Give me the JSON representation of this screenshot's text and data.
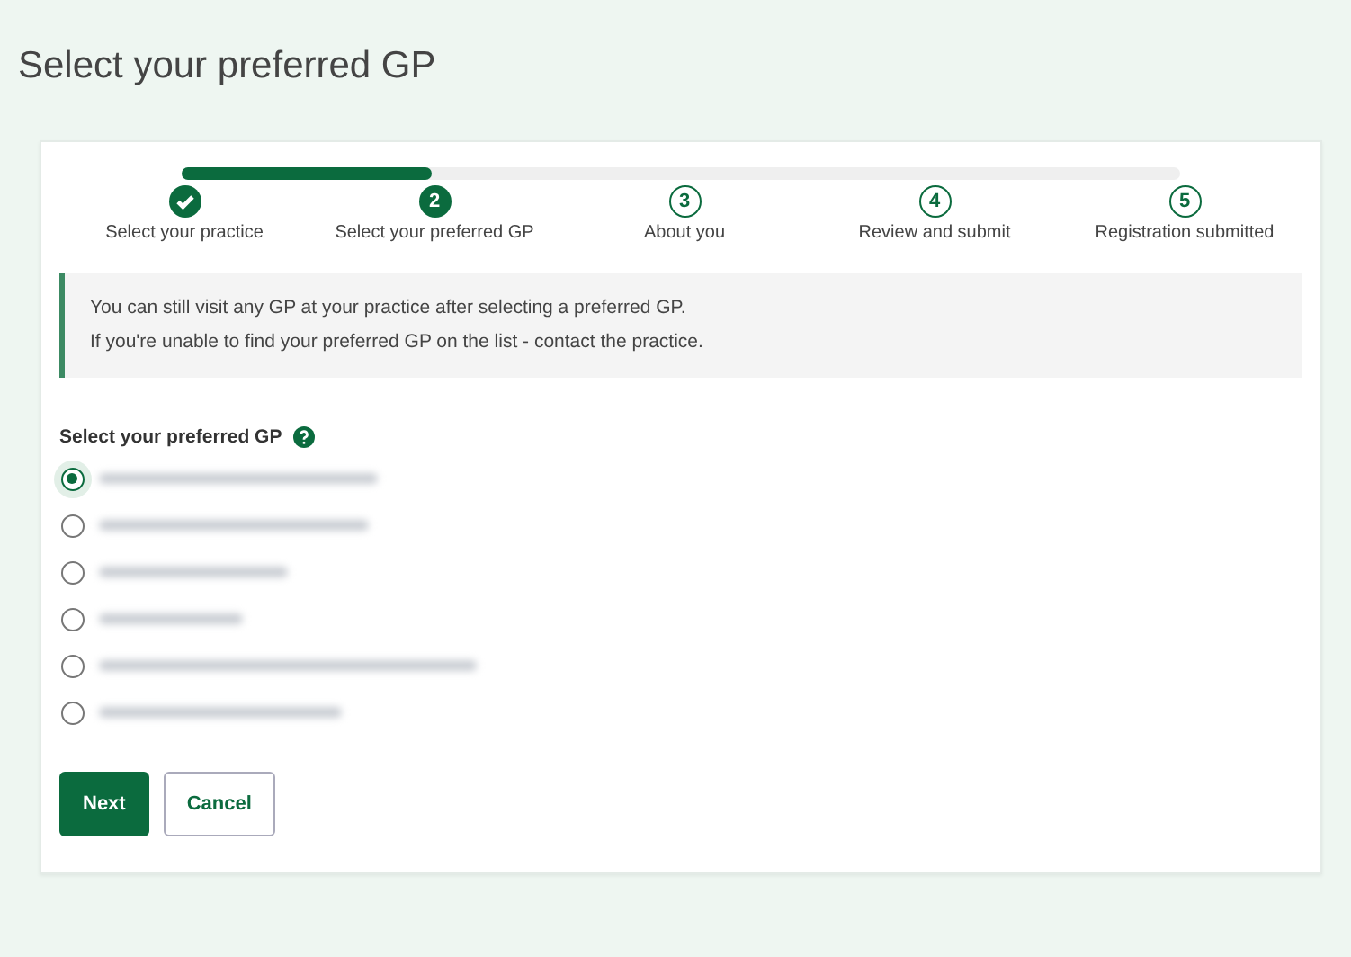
{
  "page": {
    "title": "Select your preferred GP"
  },
  "progress": {
    "level": 0.25
  },
  "steps": [
    {
      "label": "Select your practice",
      "kind": "done"
    },
    {
      "number": "2",
      "label": "Select your preferred GP",
      "kind": "current"
    },
    {
      "number": "3",
      "label": "About you",
      "kind": "upcoming"
    },
    {
      "number": "4",
      "label": "Review and submit",
      "kind": "upcoming"
    },
    {
      "number": "5",
      "label": "Registration submitted",
      "kind": "upcoming"
    }
  ],
  "notice": [
    "You can still visit any GP at your practice after selecting a preferred GP.",
    "If you're unable to find your preferred GP on the list - contact the practice."
  ],
  "gp_field": {
    "label": "Select your preferred GP",
    "options": [
      {
        "selected": true
      },
      {
        "selected": false
      },
      {
        "selected": false
      },
      {
        "selected": false
      },
      {
        "selected": false
      },
      {
        "selected": false
      }
    ]
  },
  "buttons": [
    {
      "label": "Next",
      "kind": "primary"
    },
    {
      "label": "Cancel",
      "kind": "secondary"
    }
  ]
}
